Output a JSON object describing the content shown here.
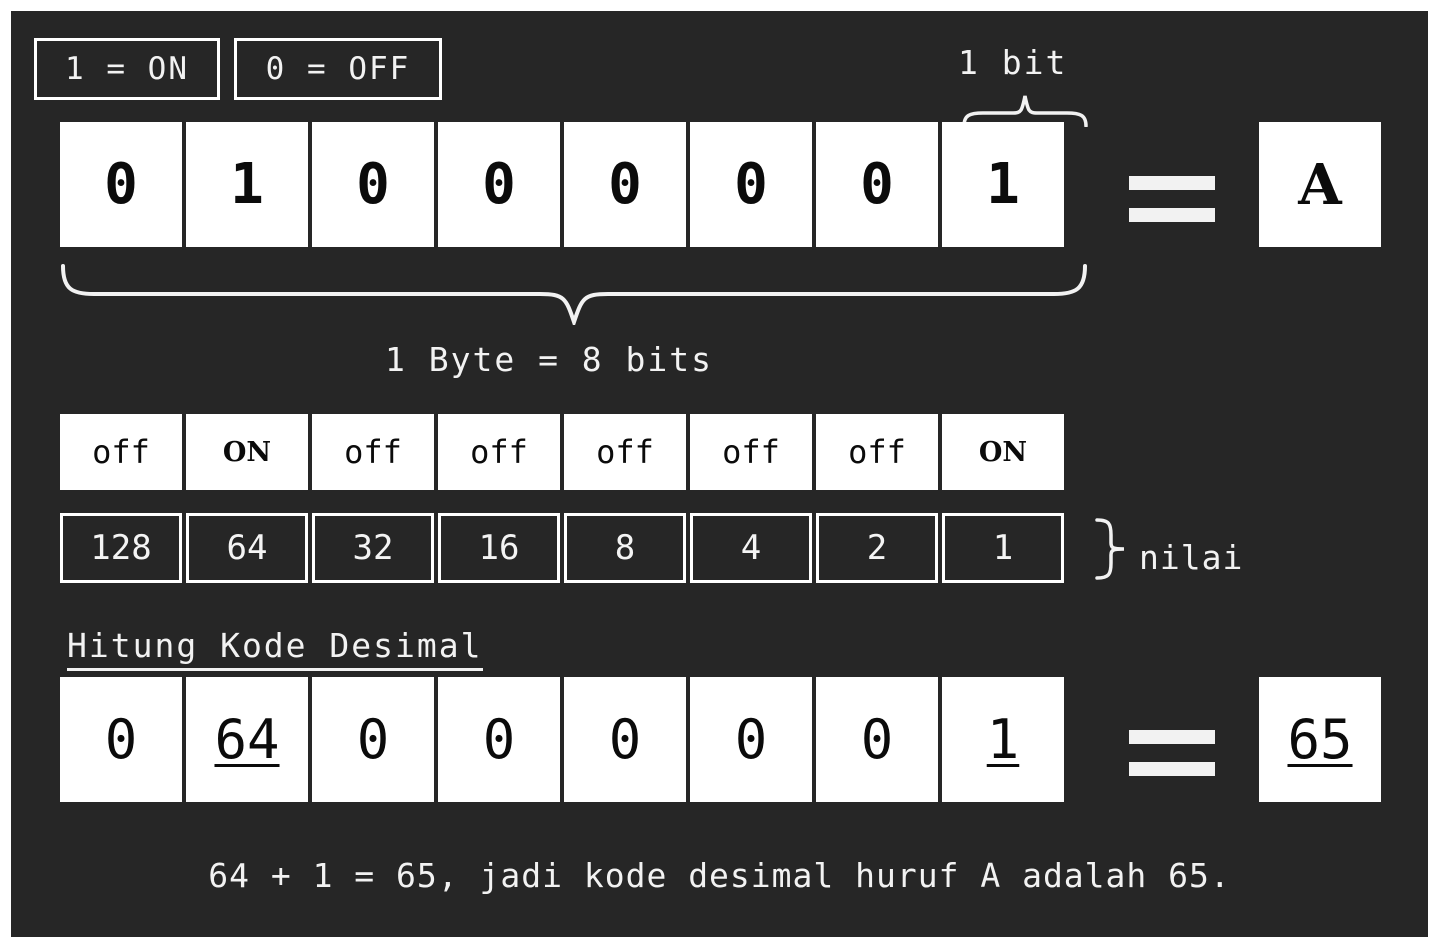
{
  "panel": {
    "background_color": "#262626",
    "text_color": "#f2f2f2",
    "cell_background": "#ffffff",
    "cell_text_color": "#0b0b0b"
  },
  "legend": {
    "on_label": "1 = ON",
    "off_label": "0 = OFF"
  },
  "labels": {
    "one_bit": "1 bit",
    "one_byte": "1 Byte = 8 bits",
    "nilai": "nilai",
    "hitung_kode_desimal": "Hitung Kode Desimal",
    "equals_symbol": "="
  },
  "binary_row": {
    "bits": [
      "0",
      "1",
      "0",
      "0",
      "0",
      "0",
      "0",
      "1"
    ],
    "result": "A"
  },
  "onoff_row": {
    "states": [
      "off",
      "ON",
      "off",
      "off",
      "off",
      "off",
      "off",
      "ON"
    ]
  },
  "nilai_row": {
    "values": [
      "128",
      "64",
      "32",
      "16",
      "8",
      "4",
      "2",
      "1"
    ]
  },
  "decimal_row": {
    "values": [
      "0",
      "64",
      "0",
      "0",
      "0",
      "0",
      "0",
      "1"
    ],
    "underlined": [
      false,
      true,
      false,
      false,
      false,
      false,
      false,
      true
    ],
    "result": "65",
    "result_underlined": true
  },
  "caption": "64 + 1 = 65, jadi kode desimal huruf A adalah 65."
}
